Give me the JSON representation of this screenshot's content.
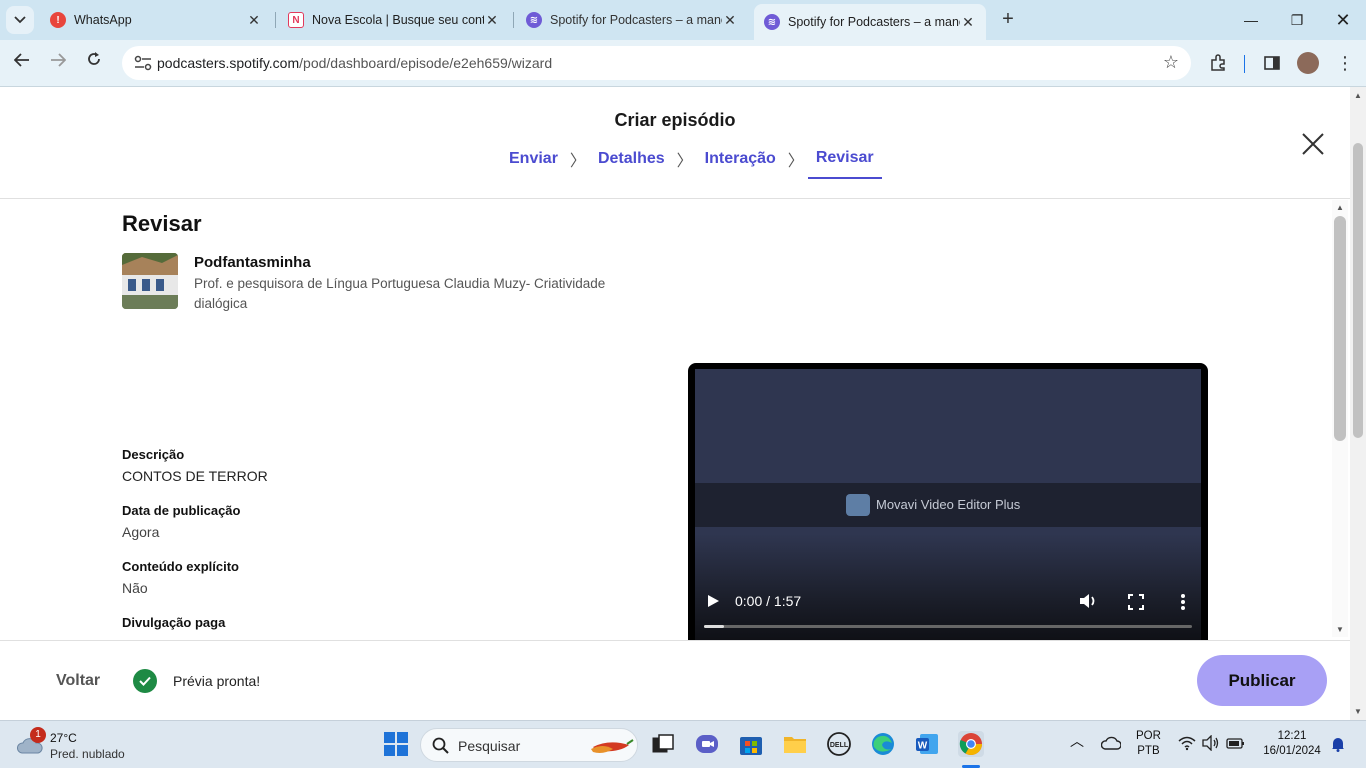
{
  "browser": {
    "tabs": [
      {
        "title": "WhatsApp",
        "favicon": "whatsapp-alert-icon",
        "active": false
      },
      {
        "title": "Nova Escola | Busque seu conte",
        "favicon": "nova-escola-icon",
        "active": false
      },
      {
        "title": "Spotify for Podcasters – a mane",
        "favicon": "spotify-podcasters-icon",
        "active": false
      },
      {
        "title": "Spotify for Podcasters – a mane",
        "favicon": "spotify-podcasters-icon",
        "active": true
      }
    ],
    "url_host": "podcasters.spotify.com",
    "url_path": "/pod/dashboard/episode/e2eh659/wizard"
  },
  "wizard": {
    "title": "Criar episódio",
    "steps": [
      "Enviar",
      "Detalhes",
      "Interação",
      "Revisar"
    ],
    "current_step": "Revisar"
  },
  "review": {
    "heading": "Revisar",
    "show_name": "Podfantasminha",
    "show_description": "Prof. e pesquisora de Língua Portuguesa Claudia Muzy- Criatividade dialógica",
    "fields": [
      {
        "label": "Descrição",
        "value": "CONTOS DE TERROR"
      },
      {
        "label": "Data de publicação",
        "value": "Agora"
      },
      {
        "label": "Conteúdo explícito",
        "value": "Não"
      },
      {
        "label": "Divulgação paga",
        "value": ""
      }
    ]
  },
  "video": {
    "watermark": "Movavi Video Editor Plus",
    "time": "0:00 / 1:57",
    "progress": 0.04
  },
  "footer": {
    "back_label": "Voltar",
    "status_text": "Prévia pronta!",
    "publish_label": "Publicar",
    "accent_color": "#a8a0f5"
  },
  "taskbar": {
    "weather_temp": "27°C",
    "weather_condition": "Pred. nublado",
    "weather_badge": "1",
    "search_placeholder": "Pesquisar",
    "lang_top": "POR",
    "lang_bottom": "PTB",
    "clock_time": "12:21",
    "clock_date": "16/01/2024"
  }
}
